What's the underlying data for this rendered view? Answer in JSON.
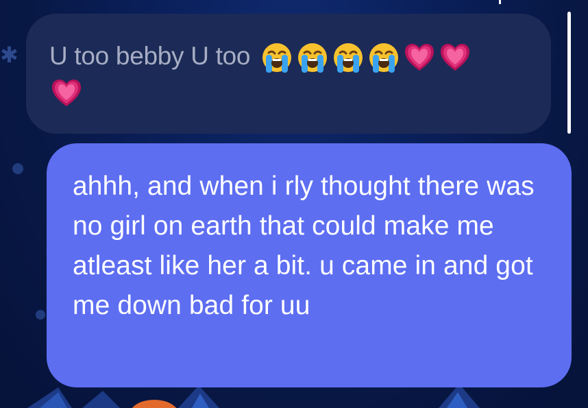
{
  "conversation": {
    "received_message": {
      "text": "U too bebby U too",
      "emojis": [
        "loudly-crying-face",
        "loudly-crying-face",
        "loudly-crying-face",
        "loudly-crying-face",
        "growing-heart",
        "growing-heart",
        "growing-heart"
      ]
    },
    "sent_message": {
      "text": "ahhh, and when i rly thought there was no girl on earth that could make me atleast like her a bit. u came in and got me down bad for uu"
    }
  },
  "colors": {
    "background": "#0a1f5a",
    "received_bubble": "#1c2a57",
    "received_text": "#a7aec4",
    "sent_bubble": "#5d6ef1",
    "sent_text": "#ffffff"
  }
}
